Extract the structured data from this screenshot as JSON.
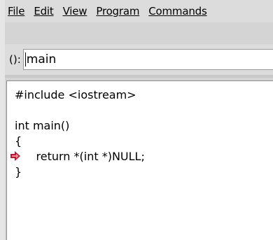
{
  "menu": {
    "items": [
      {
        "label": "File"
      },
      {
        "label": "Edit"
      },
      {
        "label": "View"
      },
      {
        "label": "Program"
      },
      {
        "label": "Commands"
      }
    ]
  },
  "argument": {
    "label": "():",
    "value": "main"
  },
  "source": {
    "lines": [
      "#include <iostream>",
      "",
      "int main()",
      "{",
      "      return *(int *)NULL;",
      "}"
    ],
    "current_line_index": 4
  },
  "colors": {
    "execution_arrow": "#c8102e"
  }
}
